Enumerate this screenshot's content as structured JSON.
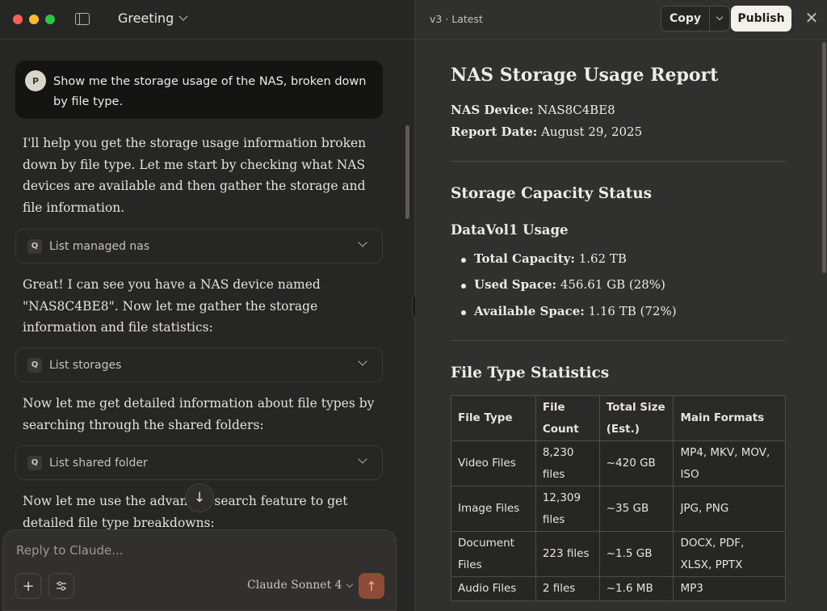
{
  "window": {
    "conversation_title": "Greeting"
  },
  "chat": {
    "user_initial": "P",
    "user_message": "Show me the storage usage of the NAS, broken down by file type.",
    "assistant_1": "I'll help you get the storage usage information broken down by file type. Let me start by checking what NAS devices are available and then gather the storage and file information.",
    "tool_1": "List managed nas",
    "assistant_2": "Great! I can see you have a NAS device named \"NAS8C4BE8\". Now let me gather the storage information and file statistics:",
    "tool_2": "List storages",
    "assistant_3": "Now let me get detailed information about file types by searching through the shared folders:",
    "tool_3": "List shared folder",
    "assistant_4": "Now let me use the advanced search feature to get detailed file type breakdowns:",
    "tool_badge": "Q"
  },
  "composer": {
    "placeholder": "Reply to Claude...",
    "model": "Claude Sonnet 4"
  },
  "artifact": {
    "version": "v3 · Latest",
    "copy_label": "Copy",
    "publish_label": "Publish",
    "title": "NAS Storage Usage Report",
    "device_label": "NAS Device:",
    "device_value": "NAS8C4BE8",
    "date_label": "Report Date:",
    "date_value": "August 29, 2025",
    "capacity_heading": "Storage Capacity Status",
    "volume_heading": "DataVol1 Usage",
    "capacity_items": [
      {
        "label": "Total Capacity:",
        "value": "1.62 TB"
      },
      {
        "label": "Used Space:",
        "value": "456.61 GB (28%)"
      },
      {
        "label": "Available Space:",
        "value": "1.16 TB (72%)"
      }
    ],
    "filetype_heading": "File Type Statistics",
    "table": {
      "headers": [
        "File Type",
        "File Count",
        "Total Size (Est.)",
        "Main Formats"
      ],
      "rows": [
        [
          "Video Files",
          "8,230 files",
          "~420 GB",
          "MP4, MKV, MOV, ISO"
        ],
        [
          "Image Files",
          "12,309 files",
          "~35 GB",
          "JPG, PNG"
        ],
        [
          "Document Files",
          "223 files",
          "~1.5 GB",
          "DOCX, PDF, XLSX, PPTX"
        ],
        [
          "Audio Files",
          "2 files",
          "~1.6 MB",
          "MP3"
        ]
      ]
    }
  }
}
